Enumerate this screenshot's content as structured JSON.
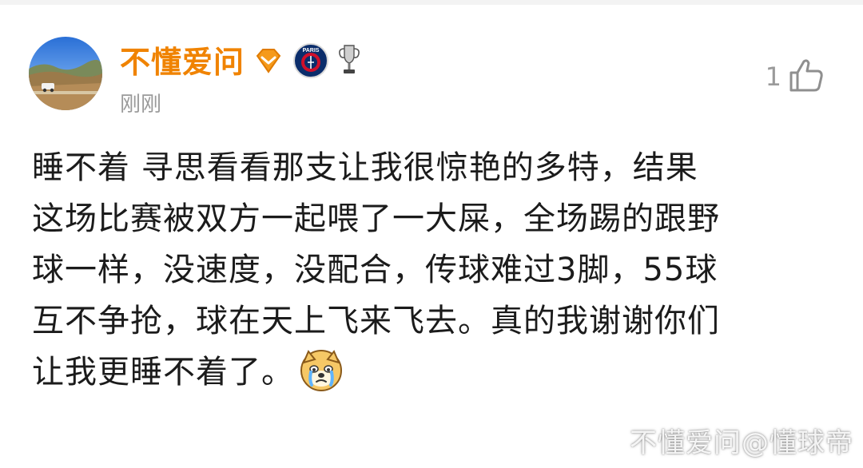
{
  "post": {
    "username": "不懂爱问",
    "time": "刚刚",
    "like_count": "1",
    "lines": [
      "睡不着 寻思看看那支让我很惊艳的多特，结果",
      "这场比赛被双方一起喂了一大屎，全场踢的跟野",
      "球一样，没速度，没配合，传球难过3脚，55球",
      "互不争抢，球在天上飞来飞去。真的我谢谢你们",
      "让我更睡不着了。"
    ]
  },
  "badges": {
    "vip_icon": "orange-diamond-badge-icon",
    "club_icon": "psg-crest-icon",
    "club_text": "PARIS",
    "trophy_icon": "champions-league-trophy-icon"
  },
  "icons": {
    "like": "thumbs-up-icon",
    "emoji": "crying-doge-emoji-icon"
  },
  "watermark": "不懂爱问@懂球帝",
  "colors": {
    "username": "#f08300",
    "meta": "#9a9a9a",
    "text": "#1b1b1b"
  }
}
